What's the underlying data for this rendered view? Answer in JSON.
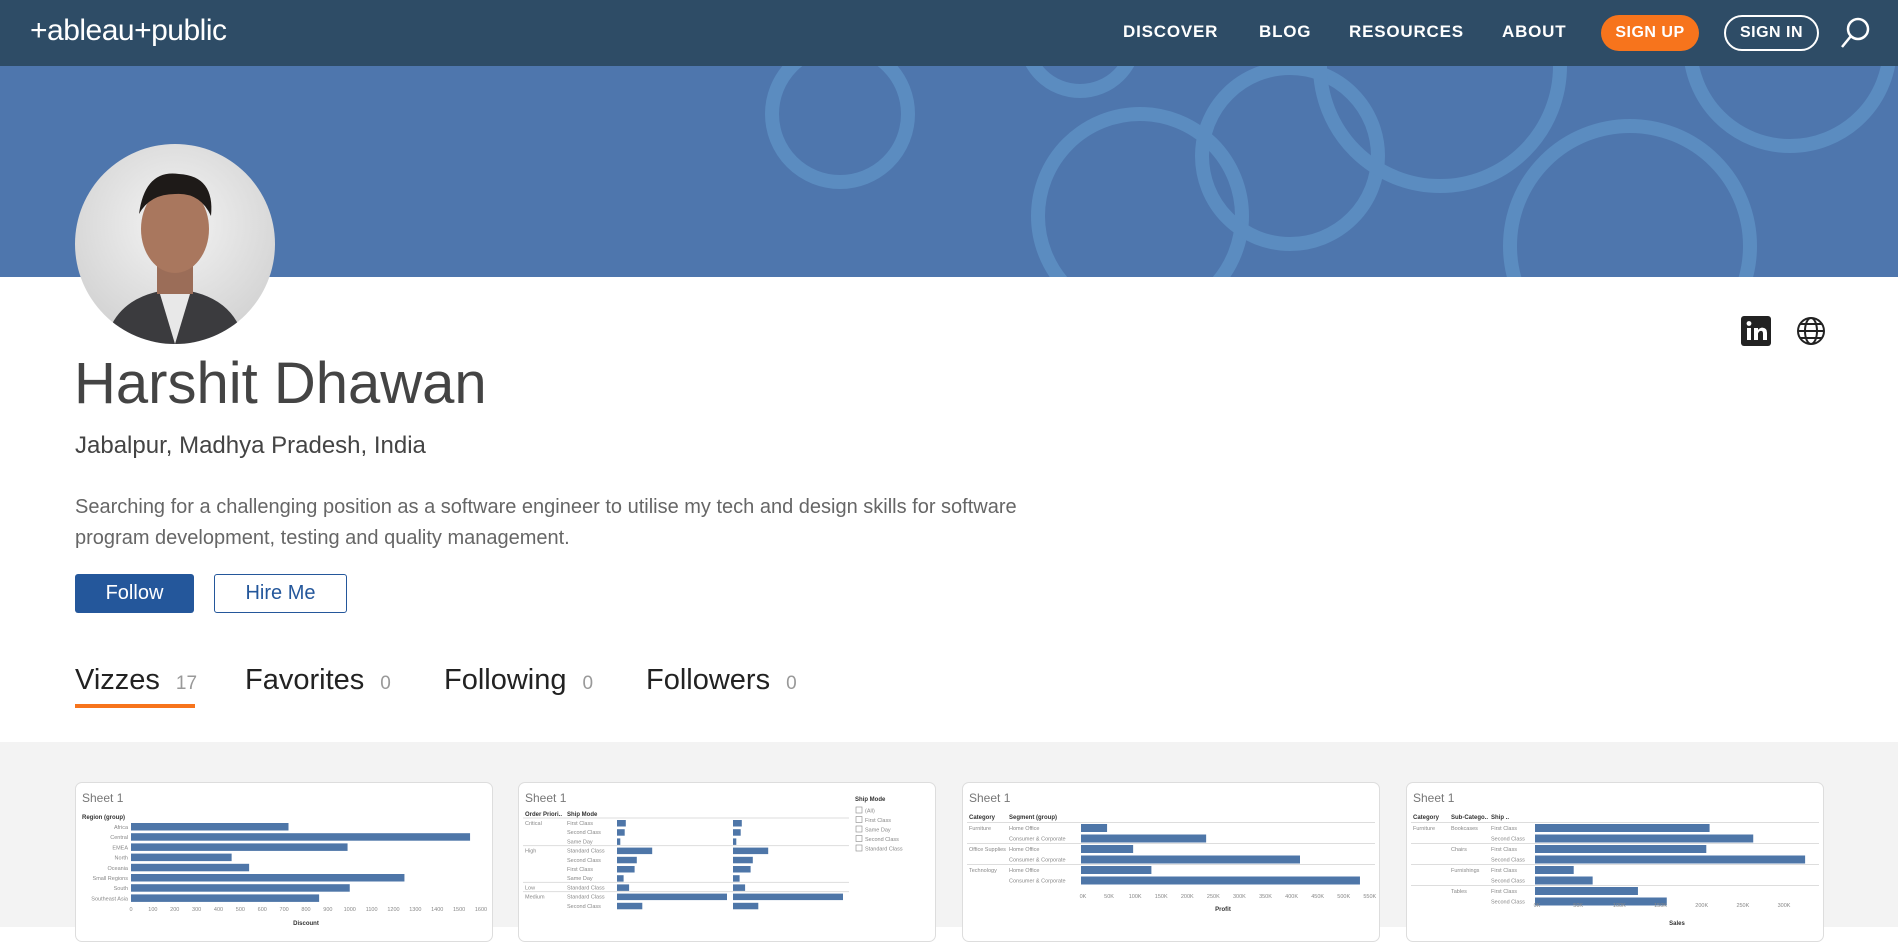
{
  "nav": {
    "logo": "+ableau+public",
    "links": [
      "DISCOVER",
      "BLOG",
      "RESOURCES",
      "ABOUT"
    ],
    "sign_up": "SIGN UP",
    "sign_in": "SIGN IN"
  },
  "profile": {
    "name": "Harshit Dhawan",
    "location": "Jabalpur, Madhya Pradesh, India",
    "bio": "Searching for a challenging position as a software engineer to utilise my tech and design skills for software program development, testing and quality management.",
    "follow": "Follow",
    "hire": "Hire Me"
  },
  "tabs": [
    {
      "label": "Vizzes",
      "count": "17"
    },
    {
      "label": "Favorites",
      "count": "0"
    },
    {
      "label": "Following",
      "count": "0"
    },
    {
      "label": "Followers",
      "count": "0"
    }
  ],
  "colors": {
    "nav": "#2e4c66",
    "banner": "#4e76ad",
    "accent": "#f7741c",
    "primary": "#24579b",
    "bar": "#4e76a8"
  },
  "vizzes": [
    {
      "title": "Sheet 1",
      "header": "Region (group)",
      "xlabel": "Discount",
      "rows": [
        "Africa",
        "Central",
        "EMEA",
        "North",
        "Oceania",
        "Small Regions",
        "South",
        "Southeast Asia"
      ],
      "values": [
        720,
        1550,
        990,
        460,
        540,
        1250,
        1000,
        860
      ],
      "max": 1600,
      "ticks": [
        "0",
        "100",
        "200",
        "300",
        "400",
        "500",
        "600",
        "700",
        "800",
        "900",
        "1000",
        "1100",
        "1200",
        "1300",
        "1400",
        "1500",
        "1600"
      ]
    },
    {
      "title": "Sheet 1",
      "headers": [
        "Order Priori..",
        "Ship Mode"
      ],
      "groups": [
        "Critical",
        "High",
        "Low",
        "Medium"
      ],
      "rows": [
        "First Class",
        "Second Class",
        "Same Day",
        "Standard Class",
        "Second Class",
        "First Class",
        "Same Day",
        "Standard Class",
        "Standard Class",
        "Second Class"
      ],
      "values": [
        8,
        7,
        3,
        32,
        18,
        16,
        6,
        11,
        100,
        23
      ],
      "legend_title": "Ship Mode",
      "legend": [
        "(All)",
        "First Class",
        "Same Day",
        "Second Class",
        "Standard Class"
      ]
    },
    {
      "title": "Sheet 1",
      "headers": [
        "Category",
        "Segment (group)"
      ],
      "groups": [
        "Furniture",
        "Office Supplies",
        "Technology"
      ],
      "rows": [
        "Home Office",
        "Consumer & Corporate",
        "Home Office",
        "Consumer & Corporate",
        "Home Office",
        "Consumer & Corporate"
      ],
      "values": [
        50,
        240,
        100,
        420,
        135,
        535
      ],
      "max": 560,
      "xlabel": "Profit",
      "ticks": [
        "0K",
        "50K",
        "100K",
        "150K",
        "200K",
        "250K",
        "300K",
        "350K",
        "400K",
        "450K",
        "500K",
        "550K"
      ]
    },
    {
      "title": "Sheet 1",
      "headers": [
        "Category",
        "Sub-Catego..",
        "Ship .."
      ],
      "groups": [
        "Furniture"
      ],
      "subs": [
        "Bookcases",
        "Chairs",
        "Furnishings",
        "Tables"
      ],
      "rows": [
        "First Class",
        "Second Class",
        "First Class",
        "Second Class",
        "First Class",
        "Second Class",
        "First Class",
        "Second Class"
      ],
      "values": [
        212,
        265,
        208,
        328,
        47,
        70,
        125,
        160
      ],
      "max": 340,
      "xlabel": "Sales",
      "ticks": [
        "0K",
        "50K",
        "100K",
        "150K",
        "200K",
        "250K",
        "300K"
      ]
    }
  ]
}
